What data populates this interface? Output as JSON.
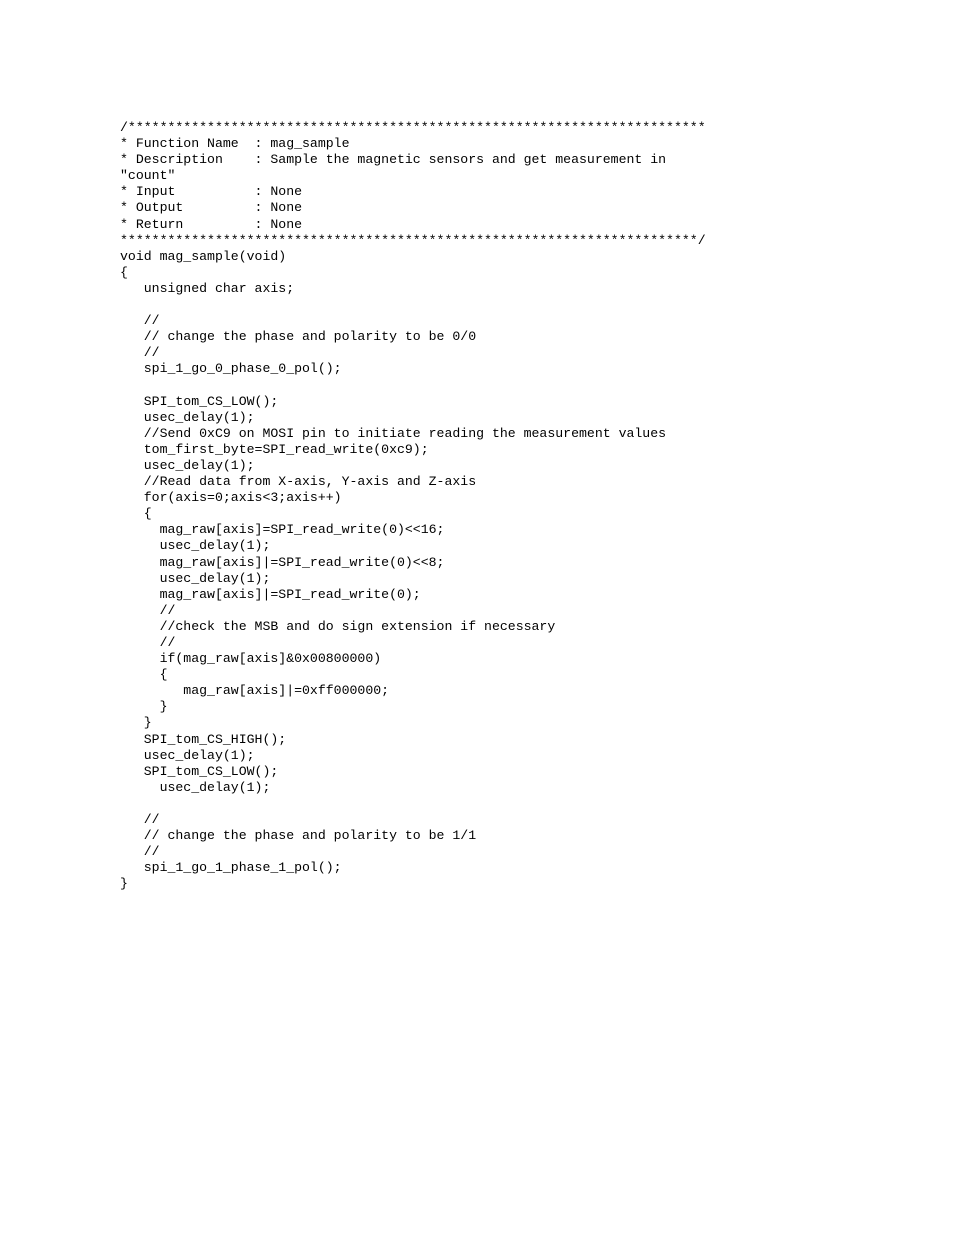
{
  "code": {
    "lines": [
      "/*************************************************************************",
      "* Function Name  : mag_sample",
      "* Description    : Sample the magnetic sensors and get measurement in",
      "\"count\"",
      "* Input          : None",
      "* Output         : None",
      "* Return         : None",
      "*************************************************************************/",
      "void mag_sample(void)",
      "{",
      "   unsigned char axis;",
      "",
      "   //",
      "   // change the phase and polarity to be 0/0",
      "   //",
      "   spi_1_go_0_phase_0_pol();",
      "",
      "   SPI_tom_CS_LOW();",
      "   usec_delay(1);",
      "   //Send 0xC9 on MOSI pin to initiate reading the measurement values",
      "   tom_first_byte=SPI_read_write(0xc9);",
      "   usec_delay(1);",
      "   //Read data from X-axis, Y-axis and Z-axis",
      "   for(axis=0;axis<3;axis++)",
      "   {",
      "     mag_raw[axis]=SPI_read_write(0)<<16;",
      "     usec_delay(1);",
      "     mag_raw[axis]|=SPI_read_write(0)<<8;",
      "     usec_delay(1);",
      "     mag_raw[axis]|=SPI_read_write(0);",
      "     //",
      "     //check the MSB and do sign extension if necessary",
      "     //",
      "     if(mag_raw[axis]&0x00800000)",
      "     {",
      "        mag_raw[axis]|=0xff000000;",
      "     }",
      "   }",
      "   SPI_tom_CS_HIGH();",
      "   usec_delay(1);",
      "   SPI_tom_CS_LOW();",
      "     usec_delay(1);",
      "",
      "   //",
      "   // change the phase and polarity to be 1/1",
      "   //",
      "   spi_1_go_1_phase_1_pol();",
      "}"
    ]
  }
}
